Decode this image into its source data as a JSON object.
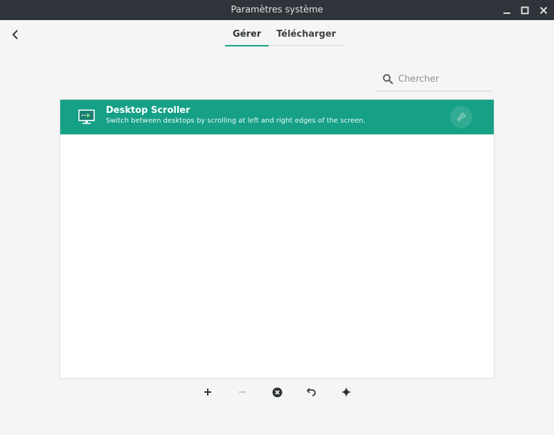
{
  "window": {
    "title": "Paramètres système"
  },
  "header": {
    "tabs": [
      {
        "label": "Gérer",
        "active": true
      },
      {
        "label": "Télécharger",
        "active": false
      }
    ]
  },
  "search": {
    "placeholder": "Chercher",
    "value": ""
  },
  "list": {
    "items": [
      {
        "name": "Desktop Scroller",
        "description": "Switch between desktops by scrolling at left and right edges of the screen.",
        "selected": true,
        "icon": "desktop-scroller-icon"
      }
    ]
  },
  "toolbar": {
    "buttons": [
      {
        "icon": "plus-icon",
        "enabled": true
      },
      {
        "icon": "minus-icon",
        "enabled": false
      },
      {
        "icon": "remove-circle-icon",
        "enabled": true
      },
      {
        "icon": "undo-icon",
        "enabled": true
      },
      {
        "icon": "sparkle-icon",
        "enabled": true
      }
    ]
  },
  "colors": {
    "accent": "#16a085",
    "titlebar": "#2f343a",
    "background": "#f5f5f5"
  }
}
